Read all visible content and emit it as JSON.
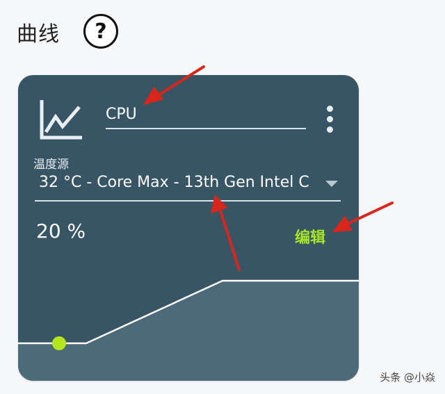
{
  "section": {
    "title": "曲线",
    "help_symbol": "?"
  },
  "card": {
    "icon": "chart-line-icon",
    "name_value": "CPU",
    "menu_icon": "more-vert-icon",
    "temperature_source": {
      "label": "温度源",
      "selected": "32 °C - Core Max - 13th Gen Intel C"
    },
    "speed_percent": "20 %",
    "edit_label": "编辑",
    "curve": {
      "fill": "#4d6a79",
      "line_color": "#ffffff",
      "point_color": "#b5e61d"
    }
  },
  "colors": {
    "card_background": "#385565",
    "accent": "#a8e22a",
    "annotation_arrow": "#d9261c"
  },
  "watermark": "头条 @小焱"
}
